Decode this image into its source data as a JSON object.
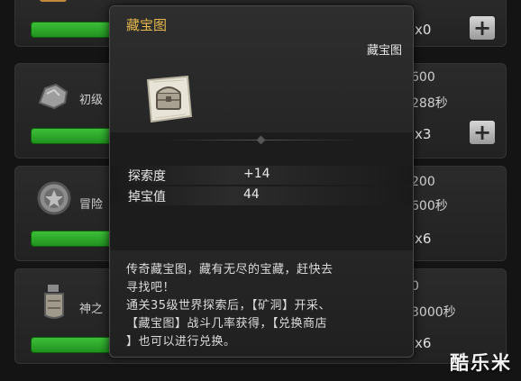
{
  "rows": [
    {
      "name": "",
      "value1": "",
      "value2": "",
      "count": "x0",
      "icon": "chest-icon"
    },
    {
      "name": "初级",
      "value1": "600",
      "value2": "288秒",
      "count": "x3",
      "icon": "rock-icon"
    },
    {
      "name": "冒险",
      "value1": "200",
      "value2": "600秒",
      "count": "x6",
      "icon": "star-coin-icon"
    },
    {
      "name": "神之",
      "value1": "0",
      "value2": "3000秒",
      "count": "x6",
      "icon": "potion-jar-icon"
    }
  ],
  "plus_label": "+",
  "popup": {
    "title": "藏宝图",
    "type": "藏宝图",
    "item_icon": "treasure-map-icon",
    "stats": [
      {
        "label": "探索度",
        "value": "+14"
      },
      {
        "label": "掉宝值",
        "value": "44"
      }
    ],
    "description_lines": [
      "传奇藏宝图，藏有无尽的宝藏，赶快去",
      "寻找吧！",
      "通关35级世界探索后，【矿洞】开采、",
      "【藏宝图】战斗几率获得，【兑换商店",
      "】也可以进行兑换。"
    ]
  },
  "watermark": "酷乐米",
  "colors": {
    "title_gold": "#e6b84d",
    "progress_green": "#3ec13a",
    "panel_dark": "#1c1c1c"
  }
}
